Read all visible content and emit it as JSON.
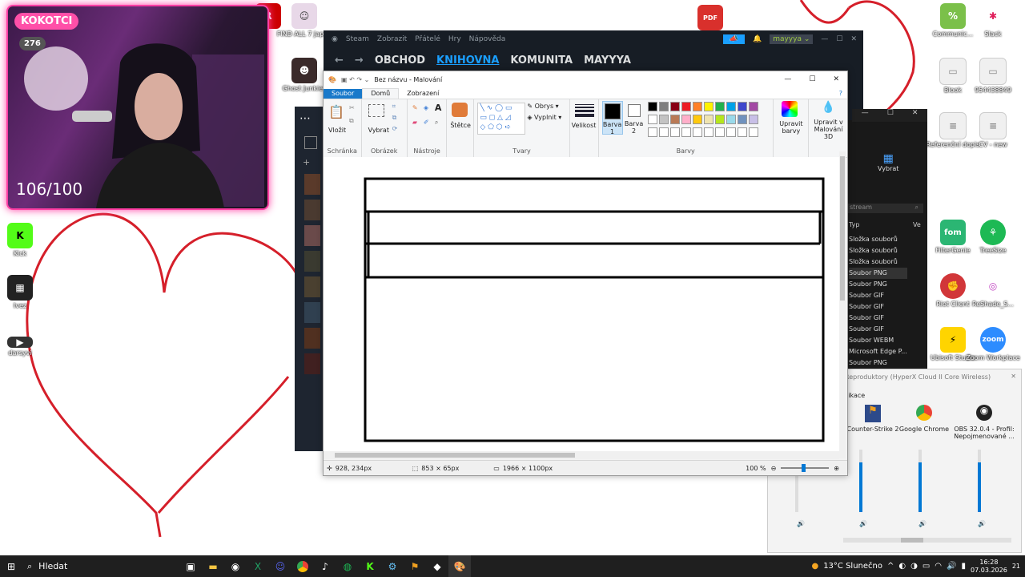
{
  "webcam": {
    "name": "KOKOTCI",
    "count": "276",
    "score": "106/100"
  },
  "desktop_icons_left": [
    {
      "label": "Kick",
      "color": "#53fc18",
      "glyph": "K"
    },
    {
      "label": "Ivez",
      "color": "#222222",
      "glyph": "▦"
    },
    {
      "label": "darsyvi",
      "color": "#333333",
      "glyph": "▶"
    }
  ],
  "desktop_icons_top": [
    {
      "label": "R",
      "color": "#cc0000",
      "glyph": "R"
    },
    {
      "label": "FIND ALL 7 Japan",
      "color": "#d8c8d8",
      "glyph": "☺"
    },
    {
      "label": "Ghost Junkies",
      "color": "#3a2a2a",
      "glyph": "☻"
    }
  ],
  "desktop_icons_right": [
    {
      "label": "Communic...",
      "color": "#7bc04a",
      "glyph": "%"
    },
    {
      "label": "Slack",
      "color": "#ffffff",
      "glyph": "✱"
    },
    {
      "label": "Blook",
      "color": "#f0f0f0",
      "glyph": "▭"
    },
    {
      "label": "954438849",
      "color": "#f0f0f0",
      "glyph": "▭"
    },
    {
      "label": "Referenční dopis",
      "color": "#f0f0f0",
      "glyph": "≡"
    },
    {
      "label": "CV - new",
      "color": "#f0f0f0",
      "glyph": "≡"
    },
    {
      "label": "FilterGenie",
      "color": "#2bb673",
      "glyph": "fom"
    },
    {
      "label": "TreeSize",
      "color": "#1db954",
      "glyph": "⚘"
    },
    {
      "label": "Riot Client",
      "color": "#d13639",
      "glyph": "✊"
    },
    {
      "label": "ReShade_S...",
      "color": "#ffffff",
      "glyph": "◎"
    },
    {
      "label": "Ubisoft Studio",
      "color": "#ffd400",
      "glyph": "⚡"
    },
    {
      "label": "Zoom Workplace",
      "color": "#2d8cff",
      "glyph": "zoom"
    }
  ],
  "steam": {
    "menu": [
      "Steam",
      "Zobrazit",
      "Přátelé",
      "Hry",
      "Nápověda"
    ],
    "nav": [
      "OBCHOD",
      "KNIHOVNA",
      "KOMUNITA",
      "MAYYYA"
    ],
    "active_nav": "KNIHOVNA",
    "user": "mayyya"
  },
  "paint": {
    "title": "Bez názvu - Malování",
    "tabs": [
      "Soubor",
      "Domů",
      "Zobrazení"
    ],
    "groups": {
      "clipboard": "Schránka",
      "paste": "Vložit",
      "image": "Obrázek",
      "select": "Vybrat",
      "tools": "Nástroje",
      "brushes": "Štětce",
      "shapes": "Tvary",
      "outline": "Obrys",
      "fill": "Vyplnit",
      "size": "Velikost",
      "color1": "Barva 1",
      "color2": "Barva 2",
      "colors": "Barvy",
      "edit_colors": "Upravit barvy",
      "paint3d": "Upravit v Malování 3D"
    },
    "palette": [
      "#000000",
      "#7f7f7f",
      "#880015",
      "#ed1c24",
      "#ff7f27",
      "#fff200",
      "#22b14c",
      "#00a2e8",
      "#3f48cc",
      "#a349a4",
      "#ffffff",
      "#c3c3c3",
      "#b97a57",
      "#ffaec9",
      "#ffc90e",
      "#efe4b0",
      "#b5e61d",
      "#99d9ea",
      "#7092be",
      "#c8bfe7"
    ],
    "status": {
      "cursor": "928, 234px",
      "selection": "853 × 65px",
      "size": "1966 × 1100px",
      "zoom": "100 %"
    }
  },
  "explorer": {
    "select": "Vybrat",
    "search": "stream",
    "col_type": "Typ",
    "col_ve": "Ve",
    "rows": [
      "Složka souborů",
      "Složka souborů",
      "Složka souborů",
      "Soubor PNG",
      "Soubor PNG",
      "Soubor GIF",
      "Soubor GIF",
      "Soubor GIF",
      "Soubor GIF",
      "Soubor WEBM",
      "Microsoft Edge P...",
      "Soubor PNG"
    ]
  },
  "audio": {
    "device": "Reproduktory (HyperX Cloud II Core Wireless)",
    "section": "likace",
    "apps": [
      {
        "name": "Counter-Strike 2",
        "level": 0.8
      },
      {
        "name": "Google Chrome",
        "level": 0.8
      },
      {
        "name": "OBS 32.0.4 - Profil: Nepojmenované ...",
        "level": 0.8
      }
    ]
  },
  "taskbar": {
    "search": "Hledat",
    "weather": "13°C  Slunečno",
    "time": "16:28",
    "date": "07.03.2026",
    "badge": "21"
  }
}
